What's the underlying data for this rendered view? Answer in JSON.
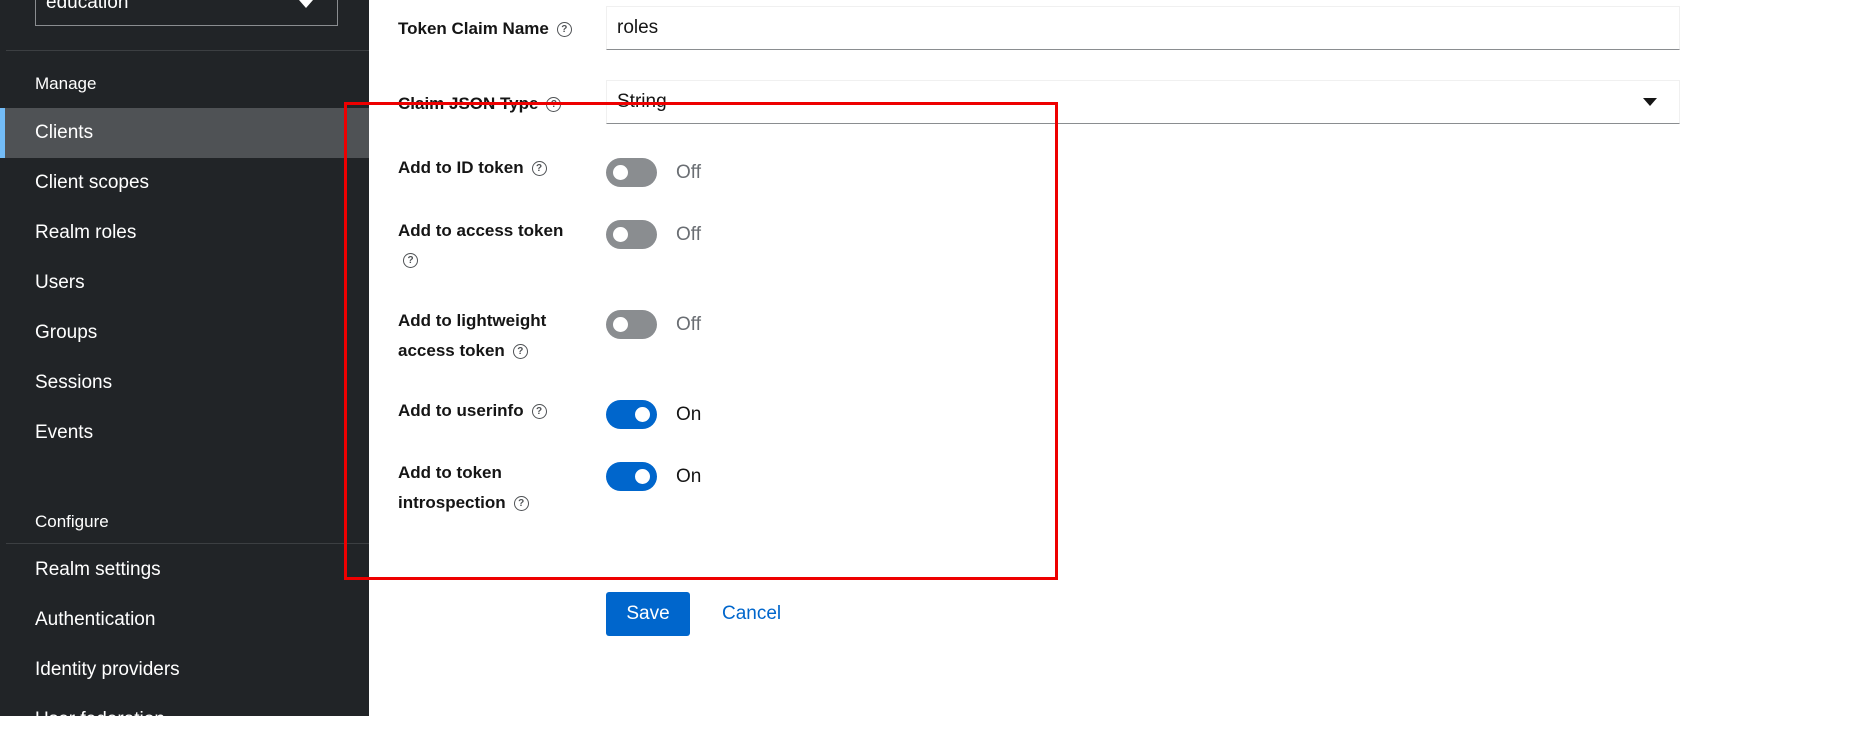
{
  "sidebar": {
    "realm": "education",
    "manage_title": "Manage",
    "manage_items": [
      {
        "label": "Clients"
      },
      {
        "label": "Client scopes"
      },
      {
        "label": "Realm roles"
      },
      {
        "label": "Users"
      },
      {
        "label": "Groups"
      },
      {
        "label": "Sessions"
      },
      {
        "label": "Events"
      }
    ],
    "configure_title": "Configure",
    "configure_items": [
      {
        "label": "Realm settings"
      },
      {
        "label": "Authentication"
      },
      {
        "label": "Identity providers"
      },
      {
        "label": "User federation"
      }
    ]
  },
  "form": {
    "token_claim_name": {
      "label": "Token Claim Name",
      "value": "roles"
    },
    "claim_json_type": {
      "label": "Claim JSON Type",
      "value": "String"
    },
    "id_token": {
      "label": "Add to ID token",
      "state": "Off"
    },
    "access_token": {
      "label": "Add to access token",
      "state": "Off"
    },
    "lightweight_access_token": {
      "label_line1": "Add to lightweight",
      "label_line2": "access token",
      "state": "Off"
    },
    "userinfo": {
      "label": "Add to userinfo",
      "state": "On"
    },
    "token_introspection": {
      "label_line1": "Add to token",
      "label_line2": "introspection",
      "state": "On"
    },
    "help_glyph": "?"
  },
  "actions": {
    "save": "Save",
    "cancel": "Cancel"
  },
  "colors": {
    "primary": "#0066cc",
    "sidebar_bg": "#212427",
    "highlight": "#ee0000",
    "active_indicator": "#73bcf7"
  }
}
